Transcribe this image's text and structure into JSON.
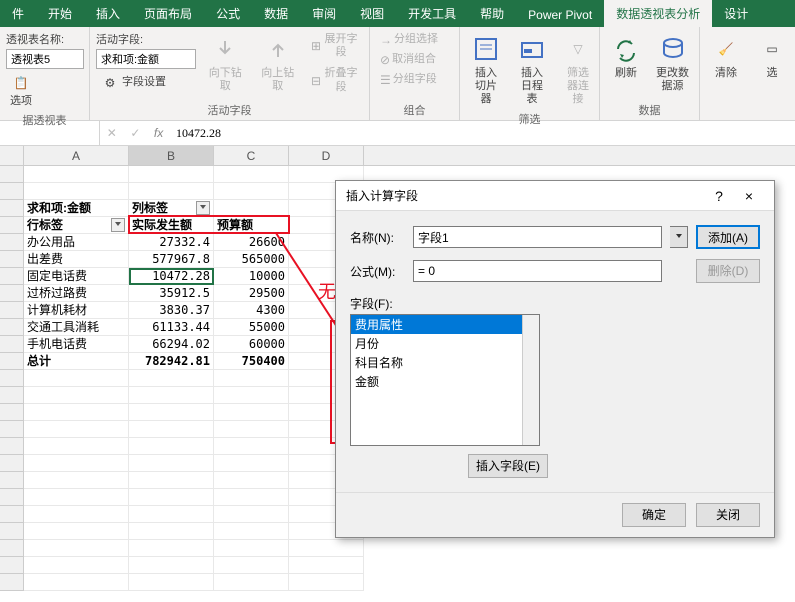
{
  "tabs": {
    "t0": "件",
    "t1": "开始",
    "t2": "插入",
    "t3": "页面布局",
    "t4": "公式",
    "t5": "数据",
    "t6": "审阅",
    "t7": "视图",
    "t8": "开发工具",
    "t9": "帮助",
    "t10": "Power Pivot",
    "t11": "数据透视表分析",
    "t12": "设计"
  },
  "ribbon": {
    "g1": {
      "name": "据透视表",
      "name_label": "透视表名称:",
      "name_value": "透视表5",
      "opt": "选项"
    },
    "g2": {
      "name": "活动字段",
      "label": "活动字段:",
      "value": "求和项:金额",
      "settings": "字段设置",
      "drilldown": "向下钻取",
      "drillup": "向上钻取",
      "expand": "展开字段",
      "collapse": "折叠字段"
    },
    "g3": {
      "name": "组合",
      "sel": "分组选择",
      "cancel": "取消组合",
      "field": "分组字段"
    },
    "g4": {
      "name": "筛选",
      "slicer": "插入切片器",
      "timeline": "插入日程表",
      "conn": "筛选器连接"
    },
    "g5": {
      "name": "数据",
      "refresh": "刷新",
      "change": "更改数据源"
    },
    "g6": {
      "clear": "清除",
      "select": "选"
    }
  },
  "namebox": "",
  "formula": "10472.28",
  "cols": {
    "A": "A",
    "B": "B",
    "C": "C",
    "D": "D"
  },
  "pivot": {
    "corner": "求和项:金额",
    "colLabel": "列标签",
    "rowLabel": "行标签",
    "h1": "实际发生额",
    "h2": "预算额",
    "r": [
      {
        "a": "办公用品",
        "b": "27332.4",
        "c": "26600"
      },
      {
        "a": "出差费",
        "b": "577967.8",
        "c": "565000"
      },
      {
        "a": "固定电话费",
        "b": "10472.28",
        "c": "10000"
      },
      {
        "a": "过桥过路费",
        "b": "35912.5",
        "c": "29500"
      },
      {
        "a": "计算机耗材",
        "b": "3830.37",
        "c": "4300"
      },
      {
        "a": "交通工具消耗",
        "b": "61133.44",
        "c": "55000"
      },
      {
        "a": "手机电话费",
        "b": "66294.02",
        "c": "60000"
      }
    ],
    "total": {
      "a": "总计",
      "b": "782942.81",
      "c": "750400"
    }
  },
  "anno": "无法添加",
  "dialog": {
    "title": "插入计算字段",
    "help": "?",
    "close": "×",
    "name_label": "名称(N):",
    "name_value": "字段1",
    "formula_label": "公式(M):",
    "formula_value": "= 0",
    "add": "添加(A)",
    "del": "删除(D)",
    "fields_label": "字段(F):",
    "fields": [
      "费用属性",
      "月份",
      "科目名称",
      "金额"
    ],
    "insert": "插入字段(E)",
    "ok": "确定",
    "cancel": "关闭"
  }
}
